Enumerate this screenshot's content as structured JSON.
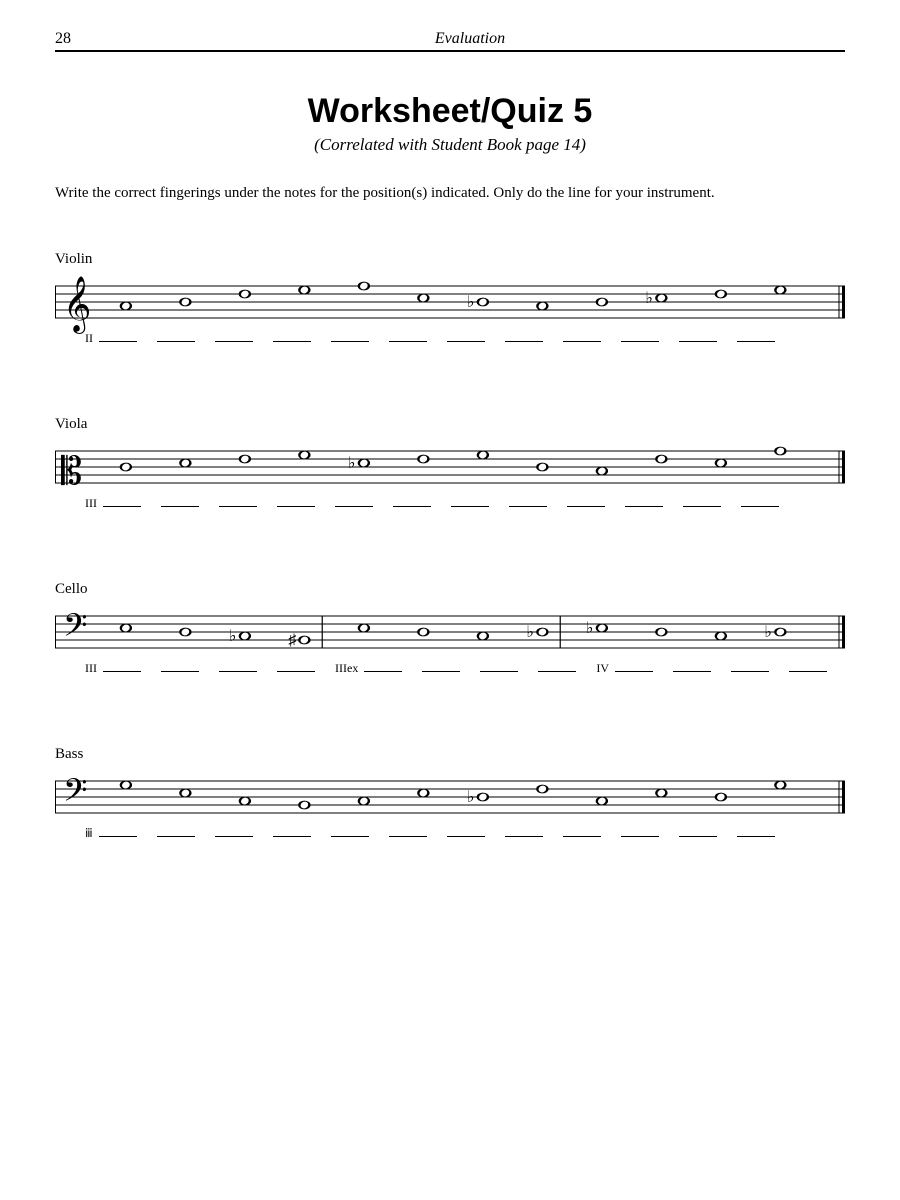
{
  "header": {
    "page_number": "28",
    "section": "Evaluation"
  },
  "title": "Worksheet/Quiz 5",
  "subtitle": "(Correlated with Student Book page 14)",
  "instructions": "Write the correct fingerings under the notes for the position(s) indicated.  Only do the line for your instrument.",
  "instruments": {
    "violin": {
      "label": "Violin",
      "clef": "treble",
      "positions": [
        "II"
      ],
      "note_count": 12,
      "notes": [
        {
          "pos": 6,
          "acc": null
        },
        {
          "pos": 5,
          "acc": null
        },
        {
          "pos": 3,
          "acc": null
        },
        {
          "pos": 2,
          "acc": null
        },
        {
          "pos": 1,
          "acc": null
        },
        {
          "pos": 4,
          "acc": null
        },
        {
          "pos": 5,
          "acc": "flat"
        },
        {
          "pos": 6,
          "acc": null
        },
        {
          "pos": 5,
          "acc": null
        },
        {
          "pos": 4,
          "acc": "flat"
        },
        {
          "pos": 3,
          "acc": null
        },
        {
          "pos": 2,
          "acc": null
        }
      ]
    },
    "viola": {
      "label": "Viola",
      "clef": "alto",
      "positions": [
        "III"
      ],
      "note_count": 12,
      "notes": [
        {
          "pos": 5,
          "acc": null
        },
        {
          "pos": 4,
          "acc": null
        },
        {
          "pos": 3,
          "acc": null
        },
        {
          "pos": 2,
          "acc": null
        },
        {
          "pos": 4,
          "acc": "flat"
        },
        {
          "pos": 3,
          "acc": null
        },
        {
          "pos": 2,
          "acc": null
        },
        {
          "pos": 5,
          "acc": null
        },
        {
          "pos": 6,
          "acc": null
        },
        {
          "pos": 3,
          "acc": null
        },
        {
          "pos": 4,
          "acc": null
        },
        {
          "pos": 1,
          "acc": null
        }
      ]
    },
    "cello": {
      "label": "Cello",
      "clef": "bass",
      "positions": [
        "III",
        "IIIex",
        "IV"
      ],
      "note_count": 12,
      "barlines": [
        4,
        8
      ],
      "notes": [
        {
          "pos": 4,
          "acc": null
        },
        {
          "pos": 5,
          "acc": null
        },
        {
          "pos": 6,
          "acc": "flat"
        },
        {
          "pos": 7,
          "acc": "sharp"
        },
        {
          "pos": 4,
          "acc": null
        },
        {
          "pos": 5,
          "acc": null
        },
        {
          "pos": 6,
          "acc": null
        },
        {
          "pos": 5,
          "acc": "flat"
        },
        {
          "pos": 4,
          "acc": "flat"
        },
        {
          "pos": 5,
          "acc": null
        },
        {
          "pos": 6,
          "acc": null
        },
        {
          "pos": 5,
          "acc": "flat"
        }
      ]
    },
    "bass": {
      "label": "Bass",
      "clef": "bass",
      "positions": [
        "ⅲ"
      ],
      "note_count": 12,
      "notes": [
        {
          "pos": 2,
          "acc": null
        },
        {
          "pos": 4,
          "acc": null
        },
        {
          "pos": 6,
          "acc": null
        },
        {
          "pos": 7,
          "acc": null
        },
        {
          "pos": 6,
          "acc": null
        },
        {
          "pos": 4,
          "acc": null
        },
        {
          "pos": 5,
          "acc": "flat"
        },
        {
          "pos": 3,
          "acc": null
        },
        {
          "pos": 6,
          "acc": null
        },
        {
          "pos": 4,
          "acc": null
        },
        {
          "pos": 5,
          "acc": null
        },
        {
          "pos": 2,
          "acc": null
        }
      ]
    }
  }
}
